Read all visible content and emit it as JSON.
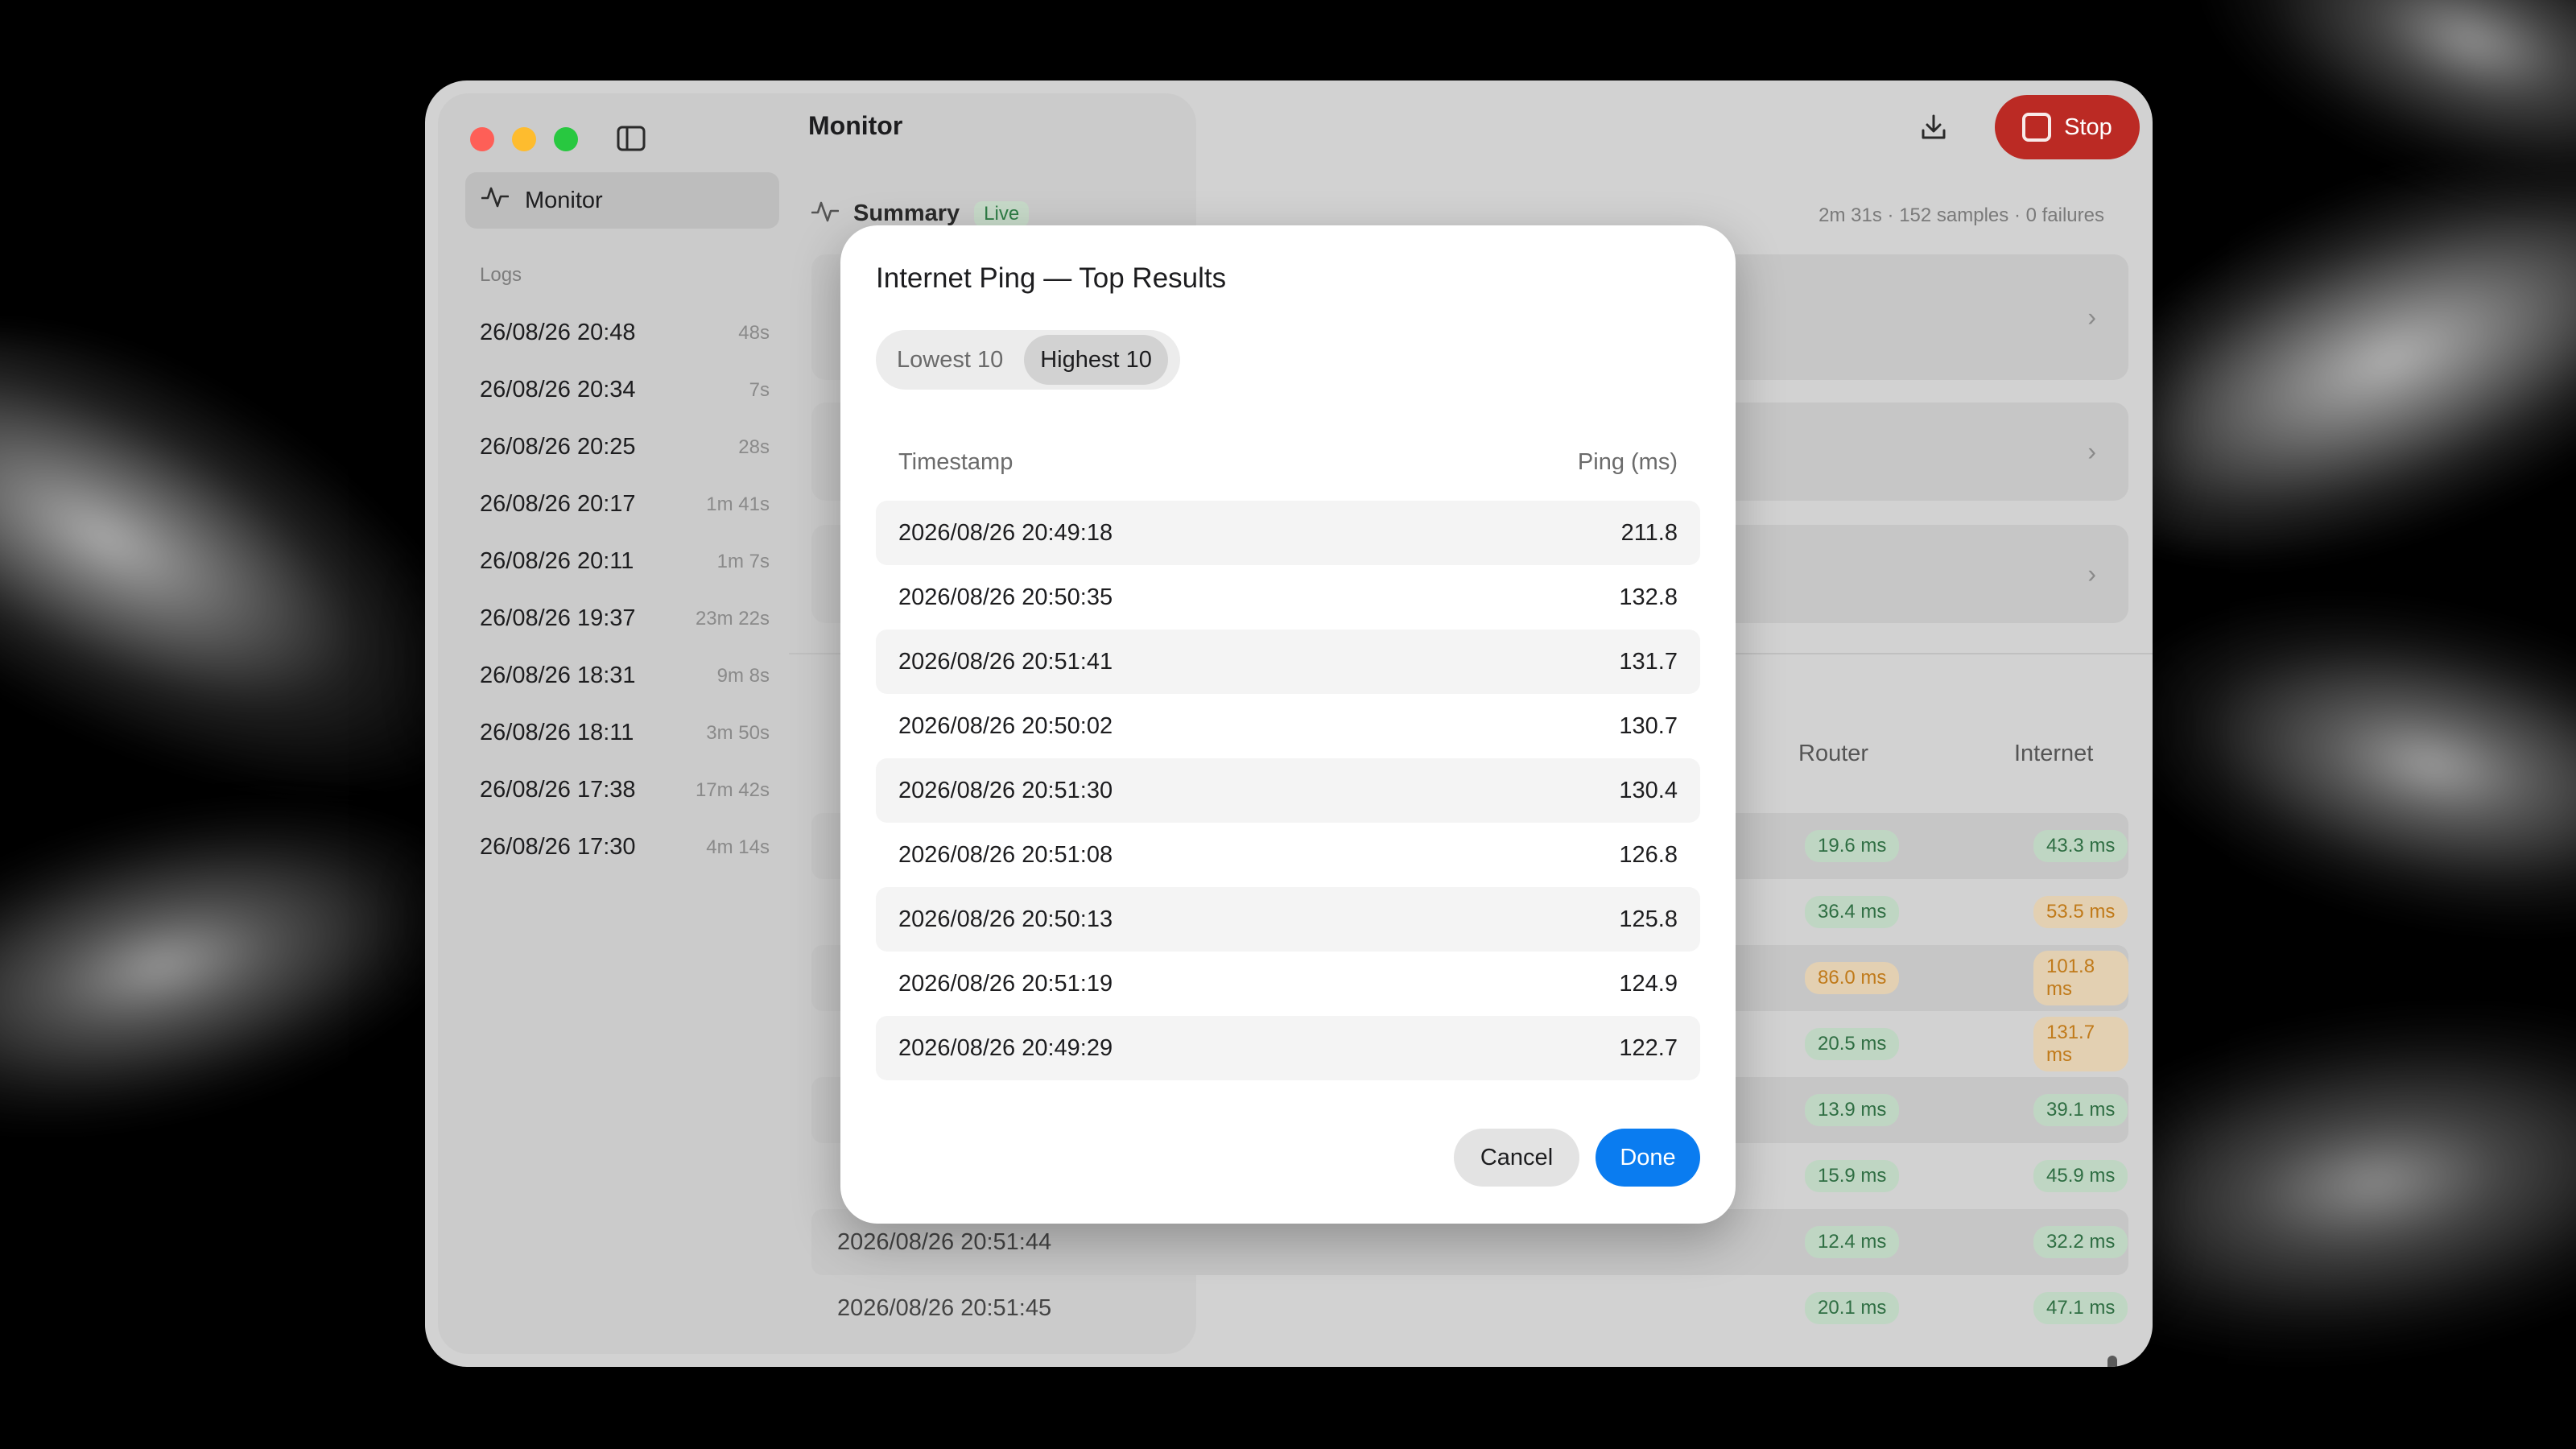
{
  "window": {
    "title": "Monitor",
    "stop_label": "Stop"
  },
  "sidebar": {
    "nav_monitor": "Monitor",
    "logs_title": "Logs",
    "logs": [
      {
        "date": "26/08/26 20:48",
        "duration": "48s"
      },
      {
        "date": "26/08/26 20:34",
        "duration": "7s"
      },
      {
        "date": "26/08/26 20:25",
        "duration": "28s"
      },
      {
        "date": "26/08/26 20:17",
        "duration": "1m 41s"
      },
      {
        "date": "26/08/26 20:11",
        "duration": "1m 7s"
      },
      {
        "date": "26/08/26 19:37",
        "duration": "23m 22s"
      },
      {
        "date": "26/08/26 18:31",
        "duration": "9m 8s"
      },
      {
        "date": "26/08/26 18:11",
        "duration": "3m 50s"
      },
      {
        "date": "26/08/26 17:38",
        "duration": "17m 42s"
      },
      {
        "date": "26/08/26 17:30",
        "duration": "4m 14s"
      }
    ]
  },
  "summary": {
    "label": "Summary",
    "live": "Live",
    "meta": "2m 31s · 152 samples · 0 failures"
  },
  "table": {
    "col_router": "Router",
    "col_internet": "Internet",
    "rows": [
      {
        "timestamp": "",
        "router": "19.6 ms",
        "internet": "43.3 ms",
        "router_status": "green",
        "internet_status": "green"
      },
      {
        "timestamp": "",
        "router": "36.4 ms",
        "internet": "53.5 ms",
        "router_status": "green",
        "internet_status": "orange"
      },
      {
        "timestamp": "",
        "router": "86.0 ms",
        "internet": "101.8 ms",
        "router_status": "orange",
        "internet_status": "orange"
      },
      {
        "timestamp": "",
        "router": "20.5 ms",
        "internet": "131.7 ms",
        "router_status": "green",
        "internet_status": "orange"
      },
      {
        "timestamp": "",
        "router": "13.9 ms",
        "internet": "39.1 ms",
        "router_status": "green",
        "internet_status": "green"
      },
      {
        "timestamp": "",
        "router": "15.9 ms",
        "internet": "45.9 ms",
        "router_status": "green",
        "internet_status": "green"
      },
      {
        "timestamp": "2026/08/26 20:51:44",
        "router": "12.4 ms",
        "internet": "32.2 ms",
        "router_status": "green",
        "internet_status": "green"
      },
      {
        "timestamp": "2026/08/26 20:51:45",
        "router": "20.1 ms",
        "internet": "47.1 ms",
        "router_status": "green",
        "internet_status": "green"
      }
    ]
  },
  "modal": {
    "title": "Internet Ping — Top Results",
    "tab_lowest": "Lowest 10",
    "tab_highest": "Highest 10",
    "col_timestamp": "Timestamp",
    "col_ping": "Ping (ms)",
    "rows": [
      {
        "timestamp": "2026/08/26 20:49:18",
        "ping": "211.8"
      },
      {
        "timestamp": "2026/08/26 20:50:35",
        "ping": "132.8"
      },
      {
        "timestamp": "2026/08/26 20:51:41",
        "ping": "131.7"
      },
      {
        "timestamp": "2026/08/26 20:50:02",
        "ping": "130.7"
      },
      {
        "timestamp": "2026/08/26 20:51:30",
        "ping": "130.4"
      },
      {
        "timestamp": "2026/08/26 20:51:08",
        "ping": "126.8"
      },
      {
        "timestamp": "2026/08/26 20:50:13",
        "ping": "125.8"
      },
      {
        "timestamp": "2026/08/26 20:51:19",
        "ping": "124.9"
      },
      {
        "timestamp": "2026/08/26 20:49:29",
        "ping": "122.7"
      }
    ],
    "cancel_label": "Cancel",
    "done_label": "Done"
  },
  "icons": {
    "monitor": "activity-icon",
    "sidebar_toggle": "sidebar-toggle-icon",
    "download": "download-icon",
    "stop": "stop-icon",
    "chevron": "chevron-right-icon"
  },
  "colors": {
    "accent": "#0a7cf0",
    "stop": "#bb2a24",
    "good": "#2f6e43",
    "warn": "#c07a1a"
  }
}
